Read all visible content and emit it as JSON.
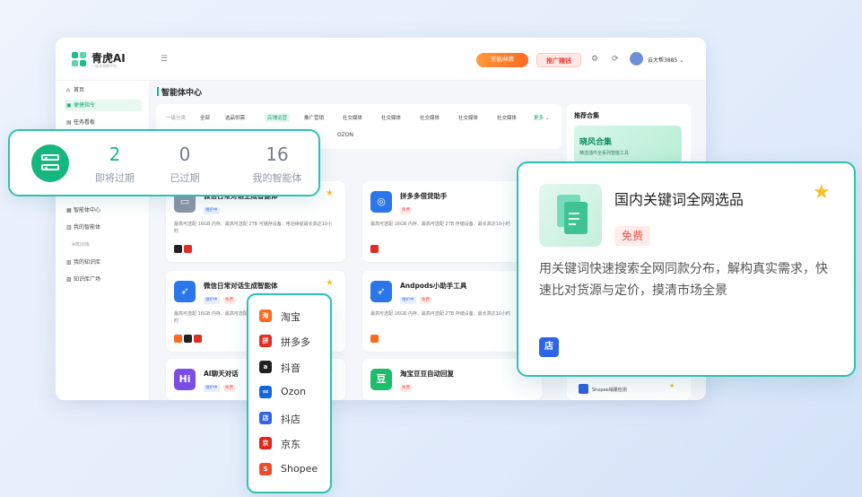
{
  "colors": {
    "accent": "#16b77f",
    "overlay_border": "#2fc1b0",
    "tag_red": "#f0524a",
    "star": "#f6c026"
  },
  "header": {
    "brand": "青虎AI",
    "brand_sub": "一站式电商平台",
    "recharge": "充值/续费",
    "promote": "推广赚钱",
    "username": "云大帮3885"
  },
  "sidebar": {
    "items_top": [
      {
        "label": "首页",
        "icon": "home-icon"
      },
      {
        "label": "便捷指令",
        "icon": "command-icon"
      },
      {
        "label": "任务看板",
        "icon": "board-icon"
      }
    ],
    "items_mid": [
      {
        "label": "智能体中心",
        "icon": "grid-icon"
      },
      {
        "label": "我的智能体",
        "icon": "agent-icon"
      }
    ],
    "group_label": "AI知识库",
    "items_kb": [
      {
        "label": "我的知识库",
        "icon": "book-icon"
      },
      {
        "label": "知识库广场",
        "icon": "plaza-icon"
      }
    ]
  },
  "main": {
    "title": "智能体中心",
    "filter_label": "一级分类",
    "filters": [
      "全部",
      "选品供需",
      "店铺运营",
      "推广营销",
      "社交媒体",
      "社交媒体",
      "社交媒体",
      "社交媒体",
      "社交媒体",
      "更多"
    ],
    "second_row_tag": "OZON"
  },
  "cards": [
    {
      "title": "微信日常对话生成智能体",
      "tags": [
        "维护中"
      ],
      "desc": "最高可选配 16GB 内存、最高可选配 2TB 可储存设备、电池续航最长高达10小时",
      "icon": "chat-icon",
      "icon_bg": "#8b95a8",
      "starred": true
    },
    {
      "title": "拼多多借贷助手",
      "tags": [
        "免费"
      ],
      "desc": "最高可选配 16GB 内存、最高可选配 2TB 存储设备、最长高达10小时",
      "icon": "swirl-icon",
      "icon_bg": "#2a76ea",
      "starred": false
    },
    {
      "title": "微信日常对话生成智能体",
      "tags": [
        "维护中",
        "免费"
      ],
      "desc": "最高可选配 16GB 内存、最高可选配 2TB 可储存设备、电池续航最长高达10小时",
      "icon": "bird-icon",
      "icon_bg": "#2a76ea",
      "starred": true
    },
    {
      "title": "Andpods小助手工具",
      "tags": [
        "维护中",
        "免费"
      ],
      "desc": "最高可选配 16GB 内存、最高可选配 2TB 存储设备、最长高达10小时",
      "icon": "bird-icon",
      "icon_bg": "#2a76ea",
      "starred": false
    },
    {
      "title": "AI聊天对话",
      "tags": [
        "维护中",
        "免费"
      ],
      "desc": "",
      "icon": "hi-icon",
      "icon_bg": "#7b4de6",
      "starred": false,
      "icon_text": "Hi"
    },
    {
      "title": "淘宝豆豆自动回复",
      "tags": [
        "免费"
      ],
      "desc": "",
      "icon": "bean-icon",
      "icon_bg": "#1bbf6a",
      "starred": false,
      "icon_text": "豆"
    }
  ],
  "right_panel": {
    "title": "推荐合集",
    "banner_title": "晓风合集",
    "banner_sub": "精选插件全系列智能工具",
    "bottom_item": "Shopee销量检测"
  },
  "stats": {
    "items": [
      {
        "value": "2",
        "label": "即将过期",
        "color": "#16b77f"
      },
      {
        "value": "0",
        "label": "已过期",
        "color": "#777d88"
      },
      {
        "value": "16",
        "label": "我的智能体",
        "color": "#777d88"
      }
    ]
  },
  "platforms": [
    {
      "name": "淘宝",
      "icon": "taobao-icon",
      "bg": "#ff6a1f",
      "glyph": "淘"
    },
    {
      "name": "拼多多",
      "icon": "pinduoduo-icon",
      "bg": "#e02e24",
      "glyph": "拼"
    },
    {
      "name": "抖音",
      "icon": "douyin-icon",
      "bg": "#222222",
      "glyph": "a"
    },
    {
      "name": "Ozon",
      "icon": "ozon-icon",
      "bg": "#1565e0",
      "glyph": "oz"
    },
    {
      "name": "抖店",
      "icon": "doudian-icon",
      "bg": "#2e65e8",
      "glyph": "店"
    },
    {
      "name": "京东",
      "icon": "jd-icon",
      "bg": "#e1251b",
      "glyph": "京"
    },
    {
      "name": "Shopee",
      "icon": "shopee-icon",
      "bg": "#ee4d2d",
      "glyph": "S"
    }
  ],
  "detail": {
    "title": "国内关键词全网选品",
    "tag": "免费",
    "desc": "用关键词快速搜索全网同款分布，解构真实需求，快速比对货源与定价，摸清市场全景",
    "platform_icon": "doudian-icon",
    "platform_glyph": "店"
  }
}
